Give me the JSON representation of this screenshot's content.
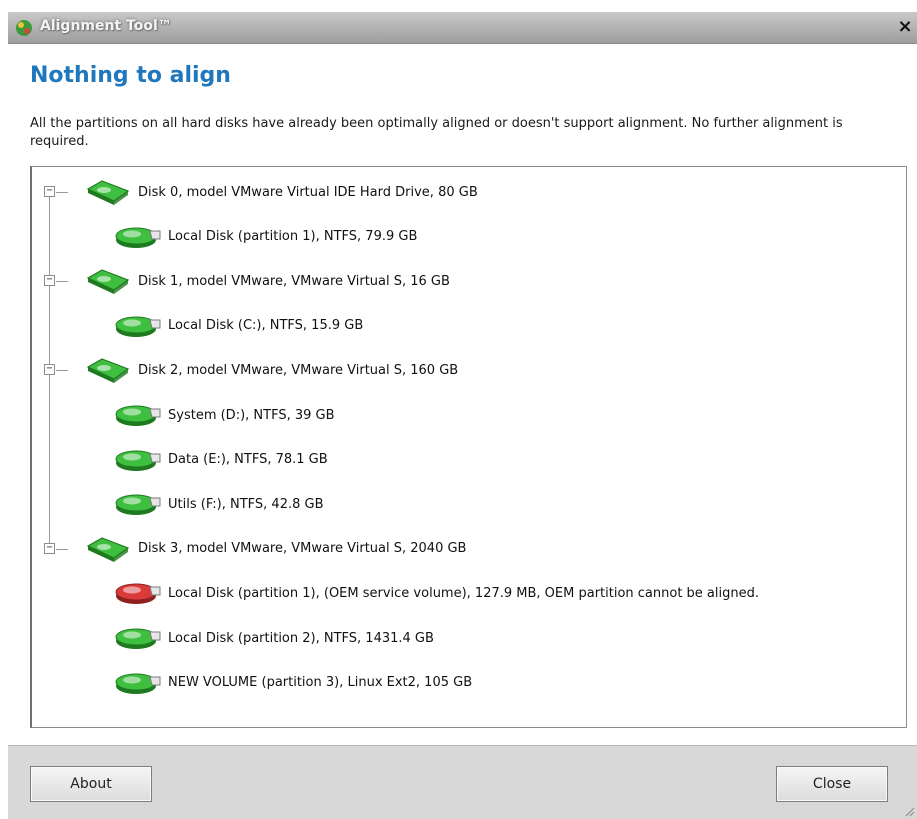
{
  "window": {
    "title": "Alignment Tool™",
    "close_glyph": "×"
  },
  "main": {
    "heading": "Nothing to align",
    "description": "All the partitions on all hard disks have already been optimally aligned or doesn't support alignment. No further alignment is required."
  },
  "tree": {
    "items": [
      {
        "kind": "disk",
        "label": "Disk 0, model VMware Virtual IDE Hard Drive, 80 GB",
        "expander": "−",
        "icon": "disk-icon",
        "status": "ok"
      },
      {
        "kind": "partition",
        "label": "Local Disk (partition 1), NTFS, 79.9 GB",
        "icon": "partition-icon",
        "status": "ok"
      },
      {
        "kind": "disk",
        "label": "Disk 1, model VMware, VMware Virtual S, 16 GB",
        "expander": "−",
        "icon": "disk-icon",
        "status": "ok"
      },
      {
        "kind": "partition",
        "label": "Local Disk (C:), NTFS, 15.9 GB",
        "icon": "partition-icon",
        "status": "ok"
      },
      {
        "kind": "disk",
        "label": "Disk 2, model VMware, VMware Virtual S, 160 GB",
        "expander": "−",
        "icon": "disk-icon",
        "status": "ok"
      },
      {
        "kind": "partition",
        "label": "System (D:), NTFS, 39 GB",
        "icon": "partition-icon",
        "status": "ok"
      },
      {
        "kind": "partition",
        "label": "Data (E:), NTFS, 78.1 GB",
        "icon": "partition-icon",
        "status": "ok"
      },
      {
        "kind": "partition",
        "label": "Utils (F:), NTFS, 42.8 GB",
        "icon": "partition-icon",
        "status": "ok"
      },
      {
        "kind": "disk",
        "label": "Disk 3, model VMware, VMware Virtual S, 2040 GB",
        "expander": "−",
        "icon": "disk-icon",
        "status": "ok"
      },
      {
        "kind": "partition",
        "label": "Local Disk (partition 1),  (OEM service volume), 127.9 MB, OEM partition cannot be aligned.",
        "icon": "partition-icon",
        "status": "error"
      },
      {
        "kind": "partition",
        "label": "Local Disk (partition 2), NTFS, 1431.4 GB",
        "icon": "partition-icon",
        "status": "ok"
      },
      {
        "kind": "partition",
        "label": "NEW VOLUME (partition 3), Linux Ext2, 105 GB",
        "icon": "partition-icon",
        "status": "ok"
      }
    ]
  },
  "footer": {
    "about_label": "About",
    "close_label": "Close"
  },
  "colors": {
    "heading": "#1f78bd",
    "ok_icon": "#3fbf3f",
    "error_icon": "#d93a3a"
  }
}
